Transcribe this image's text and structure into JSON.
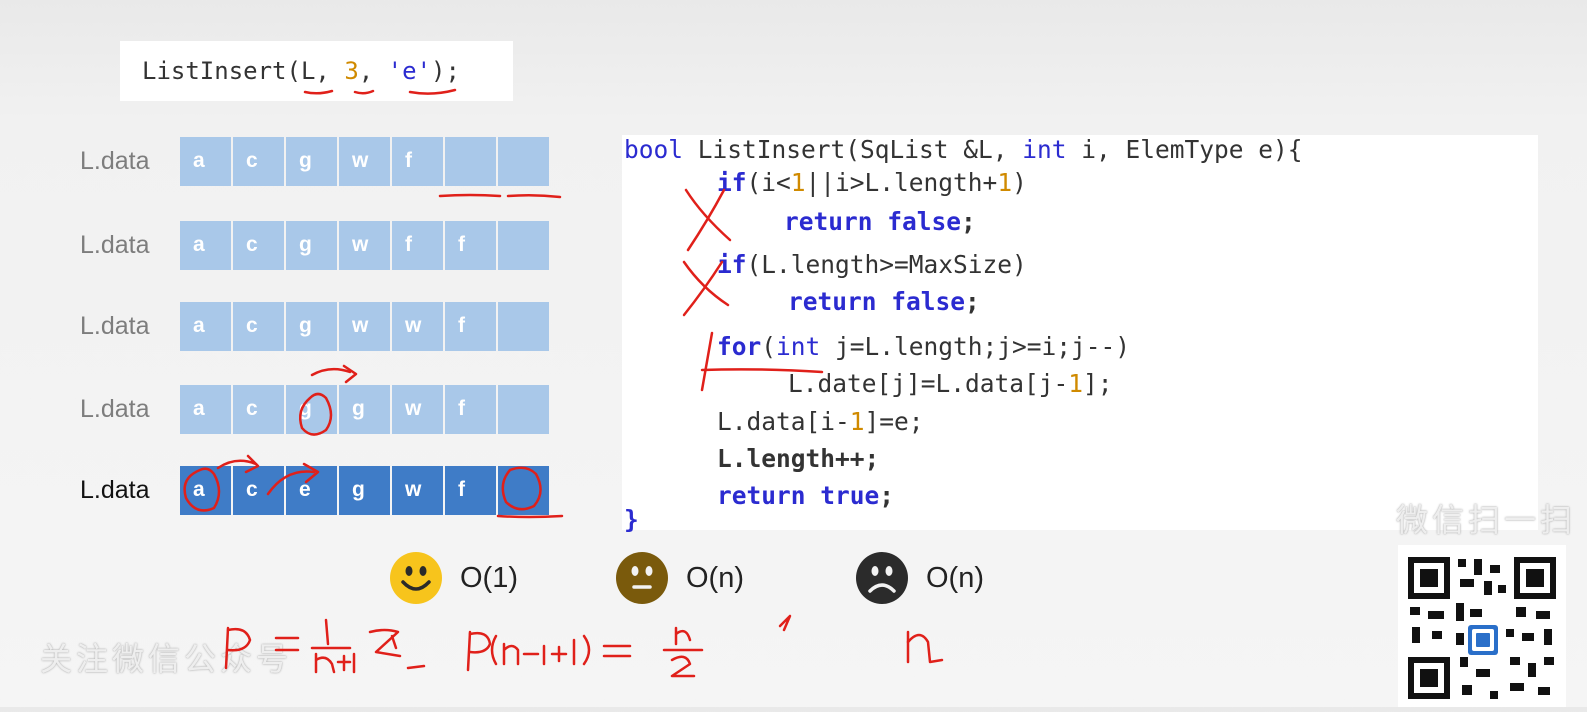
{
  "call": {
    "fn": "ListInsert(",
    "arg1": "L",
    "sep1": ", ",
    "arg2": "3",
    "sep2": ", ",
    "arg3": "'e'",
    "end": ");"
  },
  "rows": [
    {
      "label": "L.data",
      "cells": [
        "a",
        "c",
        "g",
        "w",
        "f",
        "",
        ""
      ]
    },
    {
      "label": "L.data",
      "cells": [
        "a",
        "c",
        "g",
        "w",
        "f",
        "f",
        ""
      ]
    },
    {
      "label": "L.data",
      "cells": [
        "a",
        "c",
        "g",
        "w",
        "w",
        "f",
        ""
      ]
    },
    {
      "label": "L.data",
      "cells": [
        "a",
        "c",
        "g",
        "g",
        "w",
        "f",
        ""
      ]
    },
    {
      "label": "L.data",
      "cells": [
        "a",
        "c",
        "e",
        "g",
        "w",
        "f",
        ""
      ]
    }
  ],
  "code": {
    "l1": {
      "t1": "bool ",
      "t2": "ListInsert(SqList &L, ",
      "t3": "int",
      "t4": " i, ElemType e){"
    },
    "l2": {
      "t1": "if",
      "t2": "(i<",
      "t3": "1",
      "t4": "||i>L.length+",
      "t5": "1",
      "t6": ")"
    },
    "l3": {
      "t1": "return false",
      "t2": ";"
    },
    "l4": {
      "t1": "if",
      "t2": "(L.length>=MaxSize)"
    },
    "l5": {
      "t1": "return false",
      "t2": ";"
    },
    "l6": {
      "t1": "for",
      "t2": "(",
      "t3": "int",
      "t4": " j=L.length;j>=i;j--)"
    },
    "l7": {
      "t1": "L.date[j]=L.data[j-",
      "t2": "1",
      "t3": "];"
    },
    "l8": {
      "t1": "L.data[i-",
      "t2": "1",
      "t3": "]=e;"
    },
    "l9": {
      "t1": "L.length++;"
    },
    "l10": {
      "t1": "return true",
      "t2": ";"
    },
    "l11": {
      "t1": "}"
    }
  },
  "complexity": {
    "best": "O(1)",
    "average": "O(n)",
    "worst": "O(n)"
  },
  "watermark": {
    "right": "微信扫一扫",
    "left": "关注微信公众号"
  },
  "colors": {
    "cell_light": "#a9c8e9",
    "cell_dark": "#3f7cc7",
    "keyword": "#2b2bd0",
    "number": "#d08a00",
    "ink": "#e0201a"
  }
}
